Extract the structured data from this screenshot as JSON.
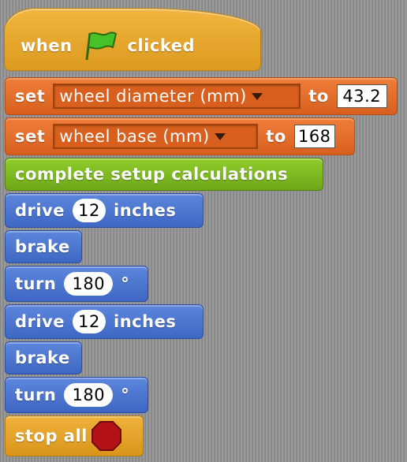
{
  "script": {
    "hat": {
      "word1": "when",
      "word2": "clicked",
      "icon": "green-flag-icon"
    },
    "set_diameter": {
      "keyword": "set",
      "variable": "wheel diameter (mm)",
      "to": "to",
      "value": "43.2"
    },
    "set_base": {
      "keyword": "set",
      "variable": "wheel base (mm)",
      "to": "to",
      "value": "168"
    },
    "setup": {
      "label": "complete setup calculations"
    },
    "drive1": {
      "keyword": "drive",
      "value": "12",
      "unit": "inches"
    },
    "brake1": {
      "label": "brake"
    },
    "turn1": {
      "keyword": "turn",
      "value": "180",
      "unit": "°"
    },
    "drive2": {
      "keyword": "drive",
      "value": "12",
      "unit": "inches"
    },
    "brake2": {
      "label": "brake"
    },
    "turn2": {
      "keyword": "turn",
      "value": "180",
      "unit": "°"
    },
    "stop": {
      "label": "stop all",
      "icon": "stop-sign-icon"
    }
  },
  "colors": {
    "hat": "#e8a52c",
    "variables": "#e36a28",
    "custom": "#7ebb22",
    "motion": "#4a74d1",
    "control": "#e6a22a",
    "stop": "#b31217"
  }
}
